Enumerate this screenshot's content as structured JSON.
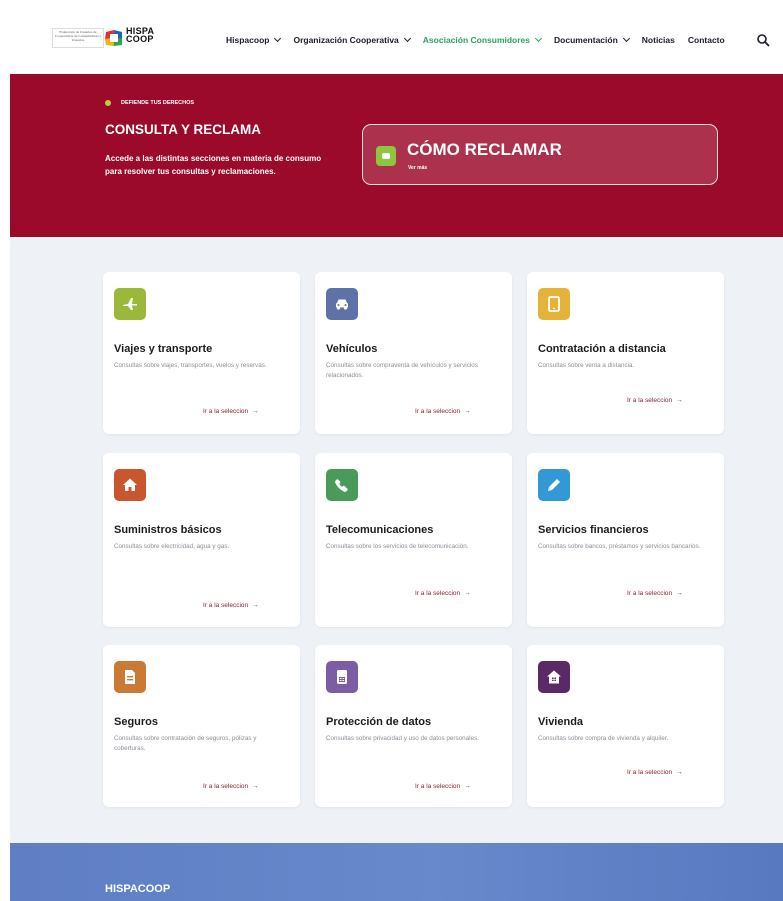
{
  "header": {
    "logo_caption": "Federación de Usuarios de Cooperativas de Consumidores y Usuarios",
    "brand_line1": "HISPA",
    "brand_line2": "COOP",
    "nav": [
      {
        "label": "Hispacoop",
        "dropdown": true,
        "active": false
      },
      {
        "label": "Organización Cooperativa",
        "dropdown": true,
        "active": false
      },
      {
        "label": "Asociación Consumidores",
        "dropdown": true,
        "active": true
      },
      {
        "label": "Documentación",
        "dropdown": true,
        "active": false
      },
      {
        "label": "Noticias",
        "dropdown": false,
        "active": false
      },
      {
        "label": "Contacto",
        "dropdown": false,
        "active": false
      }
    ],
    "search_icon": "search-icon"
  },
  "hero": {
    "eyebrow": "DEFIENDE TUS DERECHOS",
    "title": "CONSULTA Y RECLAMA",
    "description": "Accede a las distintas secciones en materia de consumo para resolver tus consultas y reclamaciones.",
    "cta_title": "CÓMO RECLAMAR",
    "cta_sub": "Ver más",
    "background": "#9b0a2b"
  },
  "cards": [
    {
      "title": "Viajes y transporte",
      "desc": "Consultas sobre viajes, transportes, vuelos y reservas.",
      "link": "Ir a la seleccion",
      "icon": "airplane-icon",
      "color": "#9bb83a"
    },
    {
      "title": "Vehículos",
      "desc": "Consultas sobre compraventa de vehículos y servicios relacionados.",
      "link": "Ir a la seleccion",
      "icon": "car-icon",
      "color": "#5d73a8"
    },
    {
      "title": "Contratación a distancia",
      "desc": "Consultas sobre venta a distancia.",
      "link": "Ir a la seleccion",
      "icon": "tablet-icon",
      "color": "#e5b33a"
    },
    {
      "title": "Suministros básicos",
      "desc": "Consultas sobre electricidad, agua y gas.",
      "link": "Ir a la seleccion",
      "icon": "home-icon",
      "color": "#c8572f"
    },
    {
      "title": "Telecomunicaciones",
      "desc": "Consultas sobre los servicios de telecomunicación.",
      "link": "Ir a la seleccion",
      "icon": "phone-icon",
      "color": "#4a9b5a"
    },
    {
      "title": "Servicios financieros",
      "desc": "Consultas sobre bancos, préstamos y servicios bancarios.",
      "link": "Ir a la seleccion",
      "icon": "pencil-icon",
      "color": "#3398d6"
    },
    {
      "title": "Seguros",
      "desc": "Consultas sobre contratación de seguros, pólizas y coberturas.",
      "link": "Ir a la seleccion",
      "icon": "document-icon",
      "color": "#c97a35"
    },
    {
      "title": "Protección de datos",
      "desc": "Consultas sobre privacidad y uso de datos personales.",
      "link": "Ir a la seleccion",
      "icon": "data-icon",
      "color": "#7b5da5"
    },
    {
      "title": "Vivienda",
      "desc": "Consultas sobre compra de vivienda y alquiler.",
      "link": "Ir a la seleccion",
      "icon": "house-icon",
      "color": "#5a2a66"
    }
  ],
  "footer": {
    "brand": "HISPACOOP"
  }
}
